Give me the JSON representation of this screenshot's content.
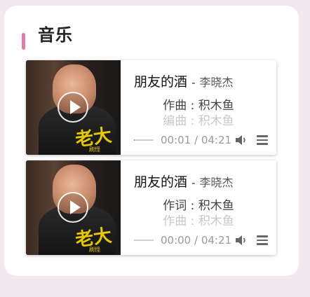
{
  "section": {
    "title": "音乐",
    "accent_color": "#e07bb0"
  },
  "players": [
    {
      "song_title": "朋友的酒",
      "separator": "-",
      "artist": "李晓杰",
      "lyric_current": "作曲 : 积木鱼",
      "lyric_next": "编曲 : 积木鱼",
      "time": "00:01 / 04:21",
      "progress_fraction": 0.004,
      "cover_text": "老大",
      "cover_subtext": "刷怪"
    },
    {
      "song_title": "朋友的酒",
      "separator": "-",
      "artist": "李晓杰",
      "lyric_current": "作词 : 积木鱼",
      "lyric_next": "作曲 : 积木鱼",
      "time": "00:00 / 04:21",
      "progress_fraction": 0.0,
      "cover_text": "老大",
      "cover_subtext": "刷怪"
    }
  ]
}
